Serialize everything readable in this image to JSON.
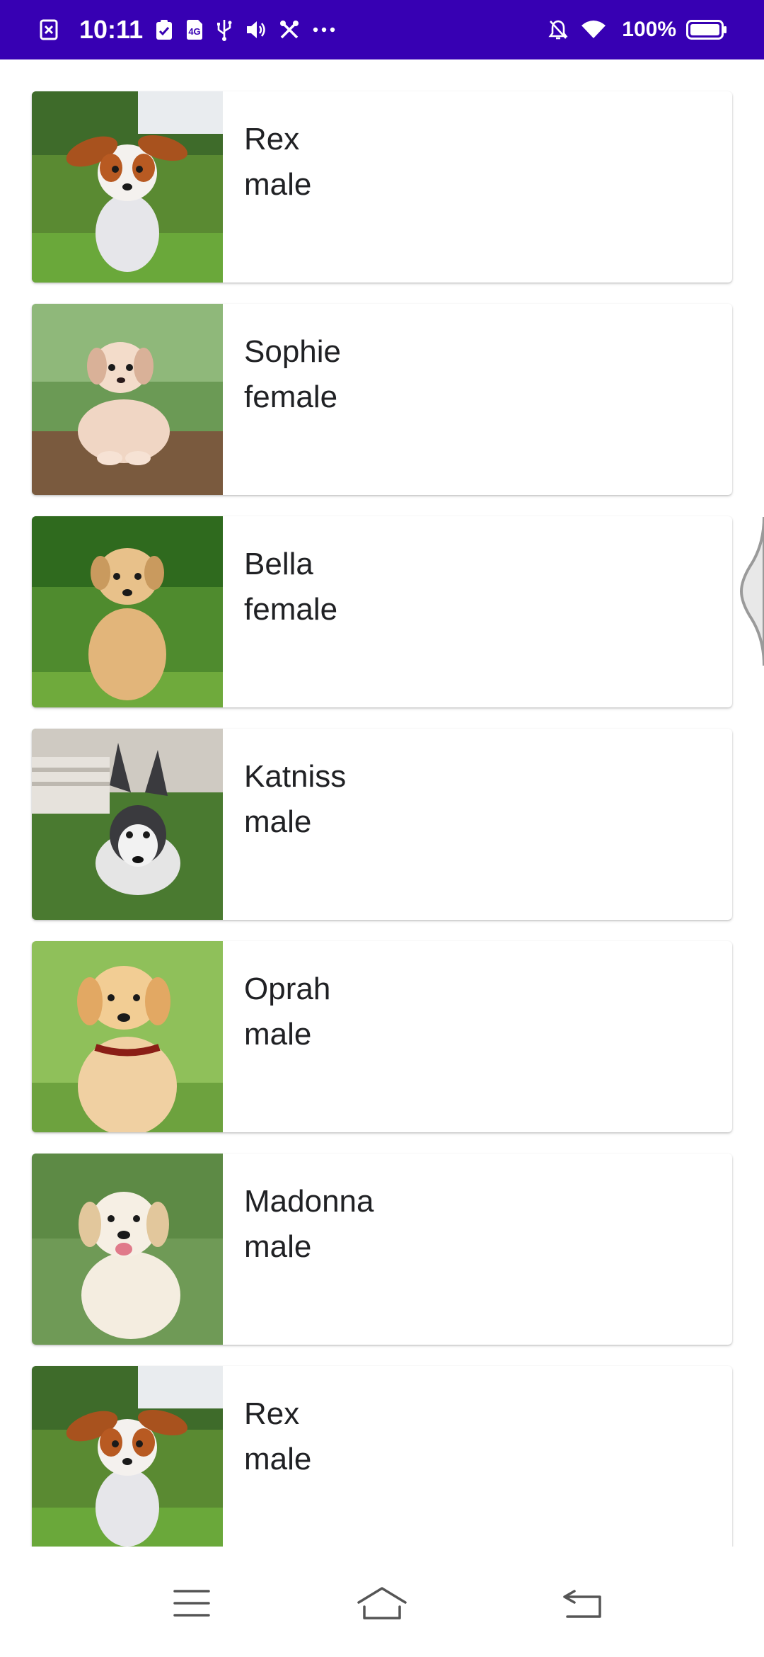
{
  "status_bar": {
    "time": "10:11",
    "battery": "100%",
    "left_icons": [
      "notification-icon",
      "clipboard-check-icon",
      "sim-icon",
      "usb-icon",
      "volume-icon",
      "tools-icon",
      "more-dots-icon"
    ],
    "right_icons": [
      "bell-off-icon",
      "wifi-icon",
      "battery-icon"
    ],
    "background_color": "#3700b3"
  },
  "dogs": [
    {
      "name": "Rex",
      "gender": "male",
      "photo": "puppy-cavalier-icon"
    },
    {
      "name": "Sophie",
      "gender": "female",
      "photo": "puppy-fluffy-icon"
    },
    {
      "name": "Bella",
      "gender": "female",
      "photo": "puppy-tan-icon"
    },
    {
      "name": "Katniss",
      "gender": "male",
      "photo": "puppy-husky-icon"
    },
    {
      "name": "Oprah",
      "gender": "male",
      "photo": "puppy-golden-icon"
    },
    {
      "name": "Madonna",
      "gender": "male",
      "photo": "puppy-retriever-icon"
    },
    {
      "name": "Rex",
      "gender": "male",
      "photo": "puppy-cavalier-icon"
    }
  ],
  "nav_bar": {
    "buttons": [
      "menu-icon",
      "home-icon",
      "back-icon"
    ]
  }
}
